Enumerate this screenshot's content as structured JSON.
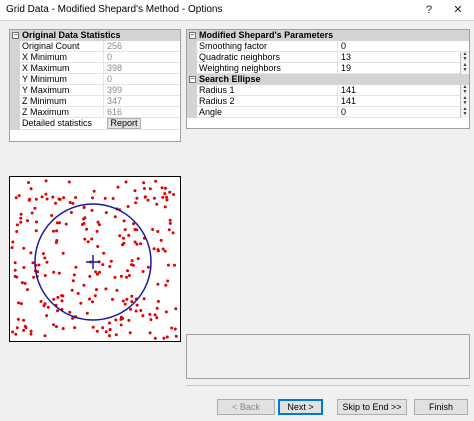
{
  "window": {
    "title": "Grid Data - Modified Shepard's Method - Options",
    "help": "?",
    "close": "✕"
  },
  "stats": {
    "header": "Original Data Statistics",
    "rows": [
      {
        "label": "Original Count",
        "value": "256"
      },
      {
        "label": "X Minimum",
        "value": "0"
      },
      {
        "label": "X Maximum",
        "value": "398"
      },
      {
        "label": "Y Minimum",
        "value": "0"
      },
      {
        "label": "Y Maximum",
        "value": "399"
      },
      {
        "label": "Z Minimum",
        "value": "347"
      },
      {
        "label": "Z Maximum",
        "value": "616"
      }
    ],
    "detailed_label": "Detailed statistics",
    "report_label": "Report"
  },
  "params": {
    "header": "Modified Shepard's Parameters",
    "rows": [
      {
        "label": "Smoothing factor",
        "value": "0"
      },
      {
        "label": "Quadratic neighbors",
        "value": "13"
      },
      {
        "label": "Weighting neighbors",
        "value": "19"
      }
    ],
    "ellipse_header": "Search Ellipse",
    "ellipse_rows": [
      {
        "label": "Radius 1",
        "value": "141"
      },
      {
        "label": "Radius 2",
        "value": "141"
      },
      {
        "label": "Angle",
        "value": "0"
      }
    ]
  },
  "preview": {
    "point_color": "#e00000",
    "ellipse_color": "#1a1a9a"
  },
  "buttons": {
    "back": "< Back",
    "next": "Next >",
    "skip": "Skip to End >>",
    "finish": "Finish"
  }
}
